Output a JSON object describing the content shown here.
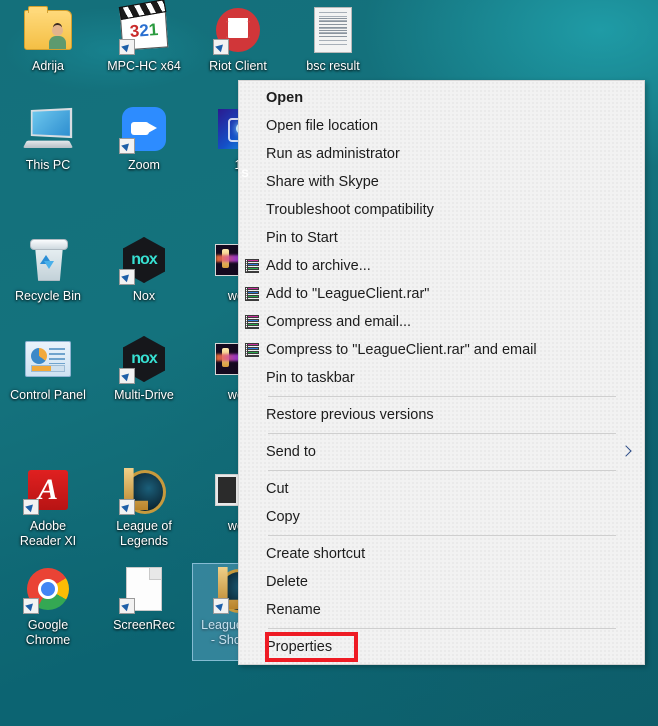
{
  "desktop": {
    "icons": [
      {
        "name": "Adrija",
        "art": "folder-user",
        "shortcut": false,
        "col": 0,
        "row": 0
      },
      {
        "name": "MPC-HC x64",
        "art": "mpc-hc",
        "shortcut": true,
        "col": 1,
        "row": 0
      },
      {
        "name": "Riot Client",
        "art": "riot-client",
        "shortcut": true,
        "col": 2,
        "row": 0
      },
      {
        "name": "bsc result",
        "art": "document-thumbnail",
        "shortcut": false,
        "col": 3,
        "row": 0
      },
      {
        "name": "This PC",
        "art": "this-pc",
        "shortcut": false,
        "col": 0,
        "row": 1
      },
      {
        "name": "Zoom",
        "art": "zoom-app",
        "shortcut": true,
        "col": 1,
        "row": 1
      },
      {
        "name": "1",
        "art": "blue-media",
        "shortcut": false,
        "col": 2,
        "row": 1
      },
      {
        "name": "Recycle Bin",
        "art": "recycle-bin",
        "shortcut": false,
        "col": 0,
        "row": 2
      },
      {
        "name": "Nox",
        "art": "nox-player",
        "shortcut": true,
        "col": 1,
        "row": 2
      },
      {
        "name": "wor",
        "art": "video-thumbnail",
        "shortcut": false,
        "col": 2,
        "row": 2
      },
      {
        "name": "Control Panel",
        "art": "control-panel",
        "shortcut": false,
        "col": 0,
        "row": 3
      },
      {
        "name": "Multi-Drive",
        "art": "nox-player",
        "shortcut": true,
        "col": 1,
        "row": 3
      },
      {
        "name": "wor",
        "art": "video-thumbnail",
        "shortcut": false,
        "col": 2,
        "row": 3
      },
      {
        "name": "Adobe\nReader XI",
        "art": "adobe-reader",
        "shortcut": true,
        "col": 0,
        "row": 4
      },
      {
        "name": "League of\nLegends",
        "art": "league-of-legends",
        "shortcut": true,
        "col": 1,
        "row": 4
      },
      {
        "name": "wor",
        "art": "photo-thumbnail",
        "shortcut": false,
        "col": 2,
        "row": 4
      },
      {
        "name": "Google\nChrome",
        "art": "google-chrome",
        "shortcut": true,
        "col": 0,
        "row": 5
      },
      {
        "name": "ScreenRec",
        "art": "blank-page",
        "shortcut": true,
        "col": 1,
        "row": 5
      },
      {
        "name": "LeagueClient\n- Shortcut",
        "art": "league-of-legends",
        "shortcut": true,
        "col": 2,
        "row": 5,
        "selected": true
      }
    ]
  },
  "context_menu": {
    "items": [
      {
        "label": "Open",
        "icon": null,
        "bold": true,
        "submenu": false
      },
      {
        "label": "Open file location",
        "icon": null,
        "bold": false,
        "submenu": false
      },
      {
        "label": "Run as administrator",
        "icon": "uac-shield-icon",
        "bold": false,
        "submenu": false
      },
      {
        "label": "Share with Skype",
        "icon": "skype-icon",
        "bold": false,
        "submenu": false
      },
      {
        "label": "Troubleshoot compatibility",
        "icon": null,
        "bold": false,
        "submenu": false
      },
      {
        "label": "Pin to Start",
        "icon": null,
        "bold": false,
        "submenu": false
      },
      {
        "label": "Add to archive...",
        "icon": "winrar-icon",
        "bold": false,
        "submenu": false
      },
      {
        "label": "Add to \"LeagueClient.rar\"",
        "icon": "winrar-icon",
        "bold": false,
        "submenu": false
      },
      {
        "label": "Compress and email...",
        "icon": "winrar-icon",
        "bold": false,
        "submenu": false
      },
      {
        "label": "Compress to \"LeagueClient.rar\" and email",
        "icon": "winrar-icon",
        "bold": false,
        "submenu": false
      },
      {
        "label": "Pin to taskbar",
        "icon": null,
        "bold": false,
        "submenu": false
      },
      {
        "separator": true
      },
      {
        "label": "Restore previous versions",
        "icon": null,
        "bold": false,
        "submenu": false
      },
      {
        "separator": true
      },
      {
        "label": "Send to",
        "icon": null,
        "bold": false,
        "submenu": true
      },
      {
        "separator": true
      },
      {
        "label": "Cut",
        "icon": null,
        "bold": false,
        "submenu": false
      },
      {
        "label": "Copy",
        "icon": null,
        "bold": false,
        "submenu": false
      },
      {
        "separator": true
      },
      {
        "label": "Create shortcut",
        "icon": null,
        "bold": false,
        "submenu": false
      },
      {
        "label": "Delete",
        "icon": null,
        "bold": false,
        "submenu": false
      },
      {
        "label": "Rename",
        "icon": null,
        "bold": false,
        "submenu": false
      },
      {
        "separator": true
      },
      {
        "label": "Properties",
        "icon": null,
        "bold": false,
        "submenu": false,
        "highlighted": true
      }
    ]
  },
  "annotation": {
    "target_label": "Properties",
    "color": "#ee1b24"
  },
  "colors": {
    "wallpaper": "#136b76",
    "menu_background": "#f2f2f2",
    "menu_text": "#1c1c1c",
    "selection": "#6eb4d7",
    "highlight_box": "#ee1b24"
  }
}
